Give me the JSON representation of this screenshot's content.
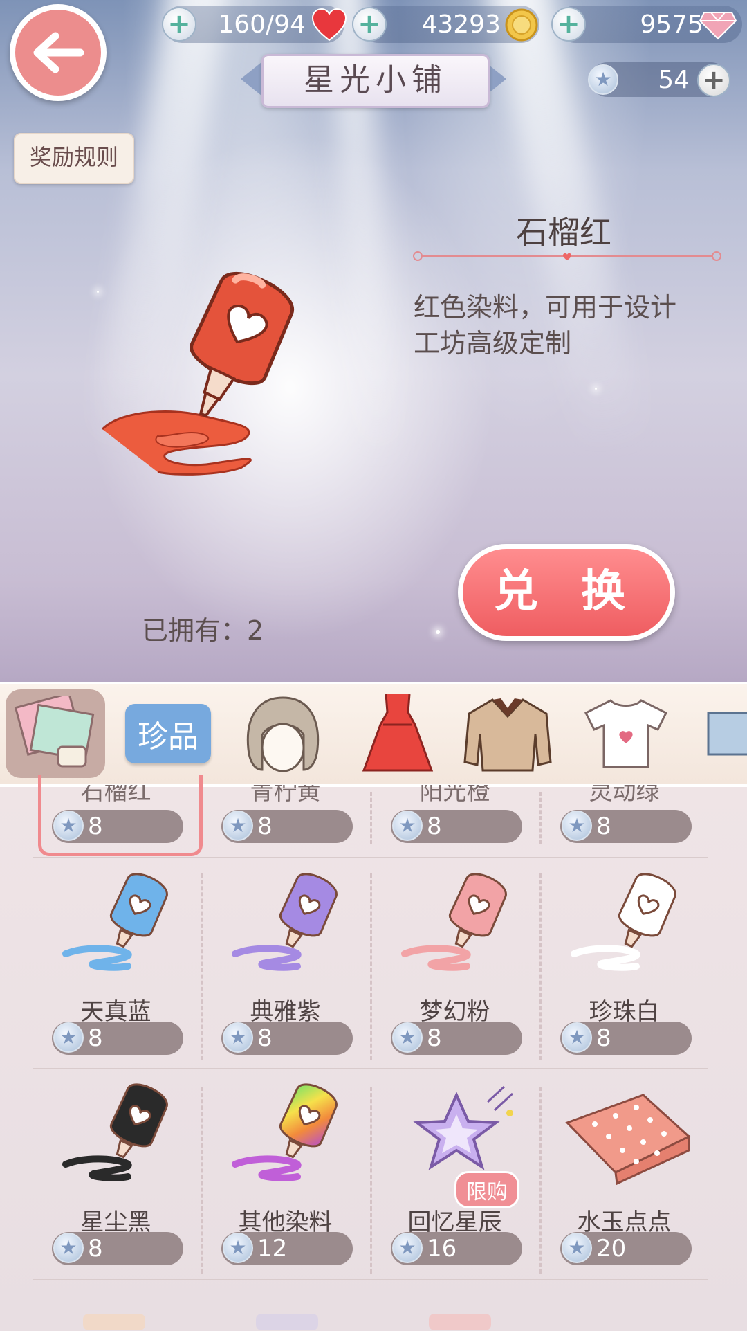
{
  "header": {
    "stamina": "160/94",
    "gold": "43293",
    "diamonds": "9575",
    "stars": "54",
    "title": "星光小铺",
    "rules_label": "奖励规则"
  },
  "detail": {
    "name": "石榴红",
    "description_line1": "红色染料，可用于设计",
    "description_line2": "工坊高级定制",
    "owned": "已拥有：2",
    "exchange_label": "兑 换"
  },
  "tabs": [
    {
      "name": "fabric-tab",
      "icon": "fabric-swatch-icon"
    },
    {
      "name": "rare-tab",
      "label": "珍品"
    },
    {
      "name": "hair-tab",
      "icon": "hair-icon"
    },
    {
      "name": "dress-tab",
      "icon": "dress-icon"
    },
    {
      "name": "coat-tab",
      "icon": "coat-icon"
    },
    {
      "name": "top-tab",
      "icon": "tshirt-icon"
    },
    {
      "name": "bottom-tab",
      "icon": "jeans-icon"
    }
  ],
  "grid": {
    "row0": [
      {
        "label": "石榴红",
        "price": "8"
      },
      {
        "label": "青柠黄",
        "price": "8"
      },
      {
        "label": "阳光橙",
        "price": "8"
      },
      {
        "label": "灵动绿",
        "price": "8"
      }
    ],
    "row1": [
      {
        "label": "天真蓝",
        "price": "8",
        "color": "#6fb3ea"
      },
      {
        "label": "典雅紫",
        "price": "8",
        "color": "#a58ae3"
      },
      {
        "label": "梦幻粉",
        "price": "8",
        "color": "#f2a3a6"
      },
      {
        "label": "珍珠白",
        "price": "8",
        "color": "#ffffff"
      }
    ],
    "row2": [
      {
        "label": "星尘黑",
        "price": "8",
        "color": "#2a2a2a"
      },
      {
        "label": "其他染料",
        "price": "12"
      },
      {
        "label": "回忆星辰",
        "price": "16",
        "badge": "限购"
      },
      {
        "label": "水玉点点",
        "price": "20"
      }
    ]
  },
  "colors": {
    "accent": "#ef5d61",
    "selected_dye": "#e2533b",
    "price_pill": "#9b8b8d",
    "rare_tab": "#77a9de"
  }
}
